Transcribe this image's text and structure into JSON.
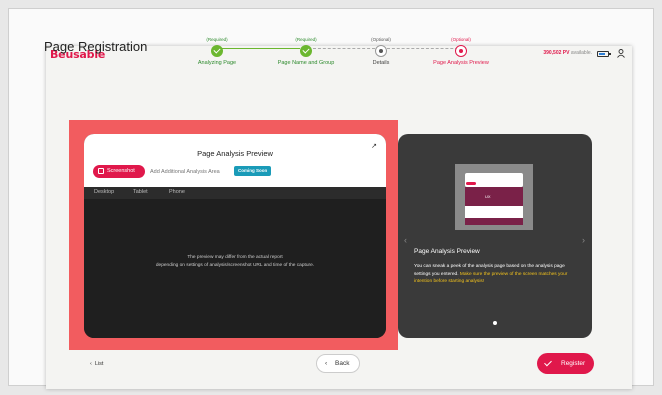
{
  "app": {
    "logo": "Beusable",
    "pv_value": "390,502 PV",
    "pv_suffix": "available."
  },
  "page_title": "Page Registration",
  "steps": [
    {
      "tag": "(Required)",
      "label": "Analyzing Page",
      "state": "done"
    },
    {
      "tag": "(Required)",
      "label": "Page Name and Group",
      "state": "done"
    },
    {
      "tag": "(Optional)",
      "label": "Details",
      "state": "pending"
    },
    {
      "tag": "(Optional)",
      "label": "Page Analysis Preview",
      "state": "current"
    }
  ],
  "preview": {
    "title": "Page Analysis Preview",
    "screenshot_label": "Screenshot",
    "area_placeholder": "Add Additional Analysis Area",
    "coming_soon": "Coming Soon",
    "device_tabs": [
      "Desktop",
      "Tablet",
      "Phone"
    ],
    "note_line1": "The preview may differ from the actual report",
    "note_line2": "depending on settings of analysis/screenshot URL and time of the capture."
  },
  "info_panel": {
    "title": "Page Analysis Preview",
    "text_white": "You can sneak a peek of the analysis page based on the analysis page settings you entered.",
    "text_yellow": "Make sure the preview of the screen matches your intention before starting analysis!",
    "mini_preview_text": "UX"
  },
  "footer": {
    "list_label": "List",
    "back_label": "Back",
    "register_label": "Register"
  },
  "colors": {
    "brand": "#e0184b",
    "done": "#6bb72f",
    "highlight": "#f25c5f",
    "coming_soon": "#1a9bb8",
    "emphasis": "#f2c21c"
  }
}
